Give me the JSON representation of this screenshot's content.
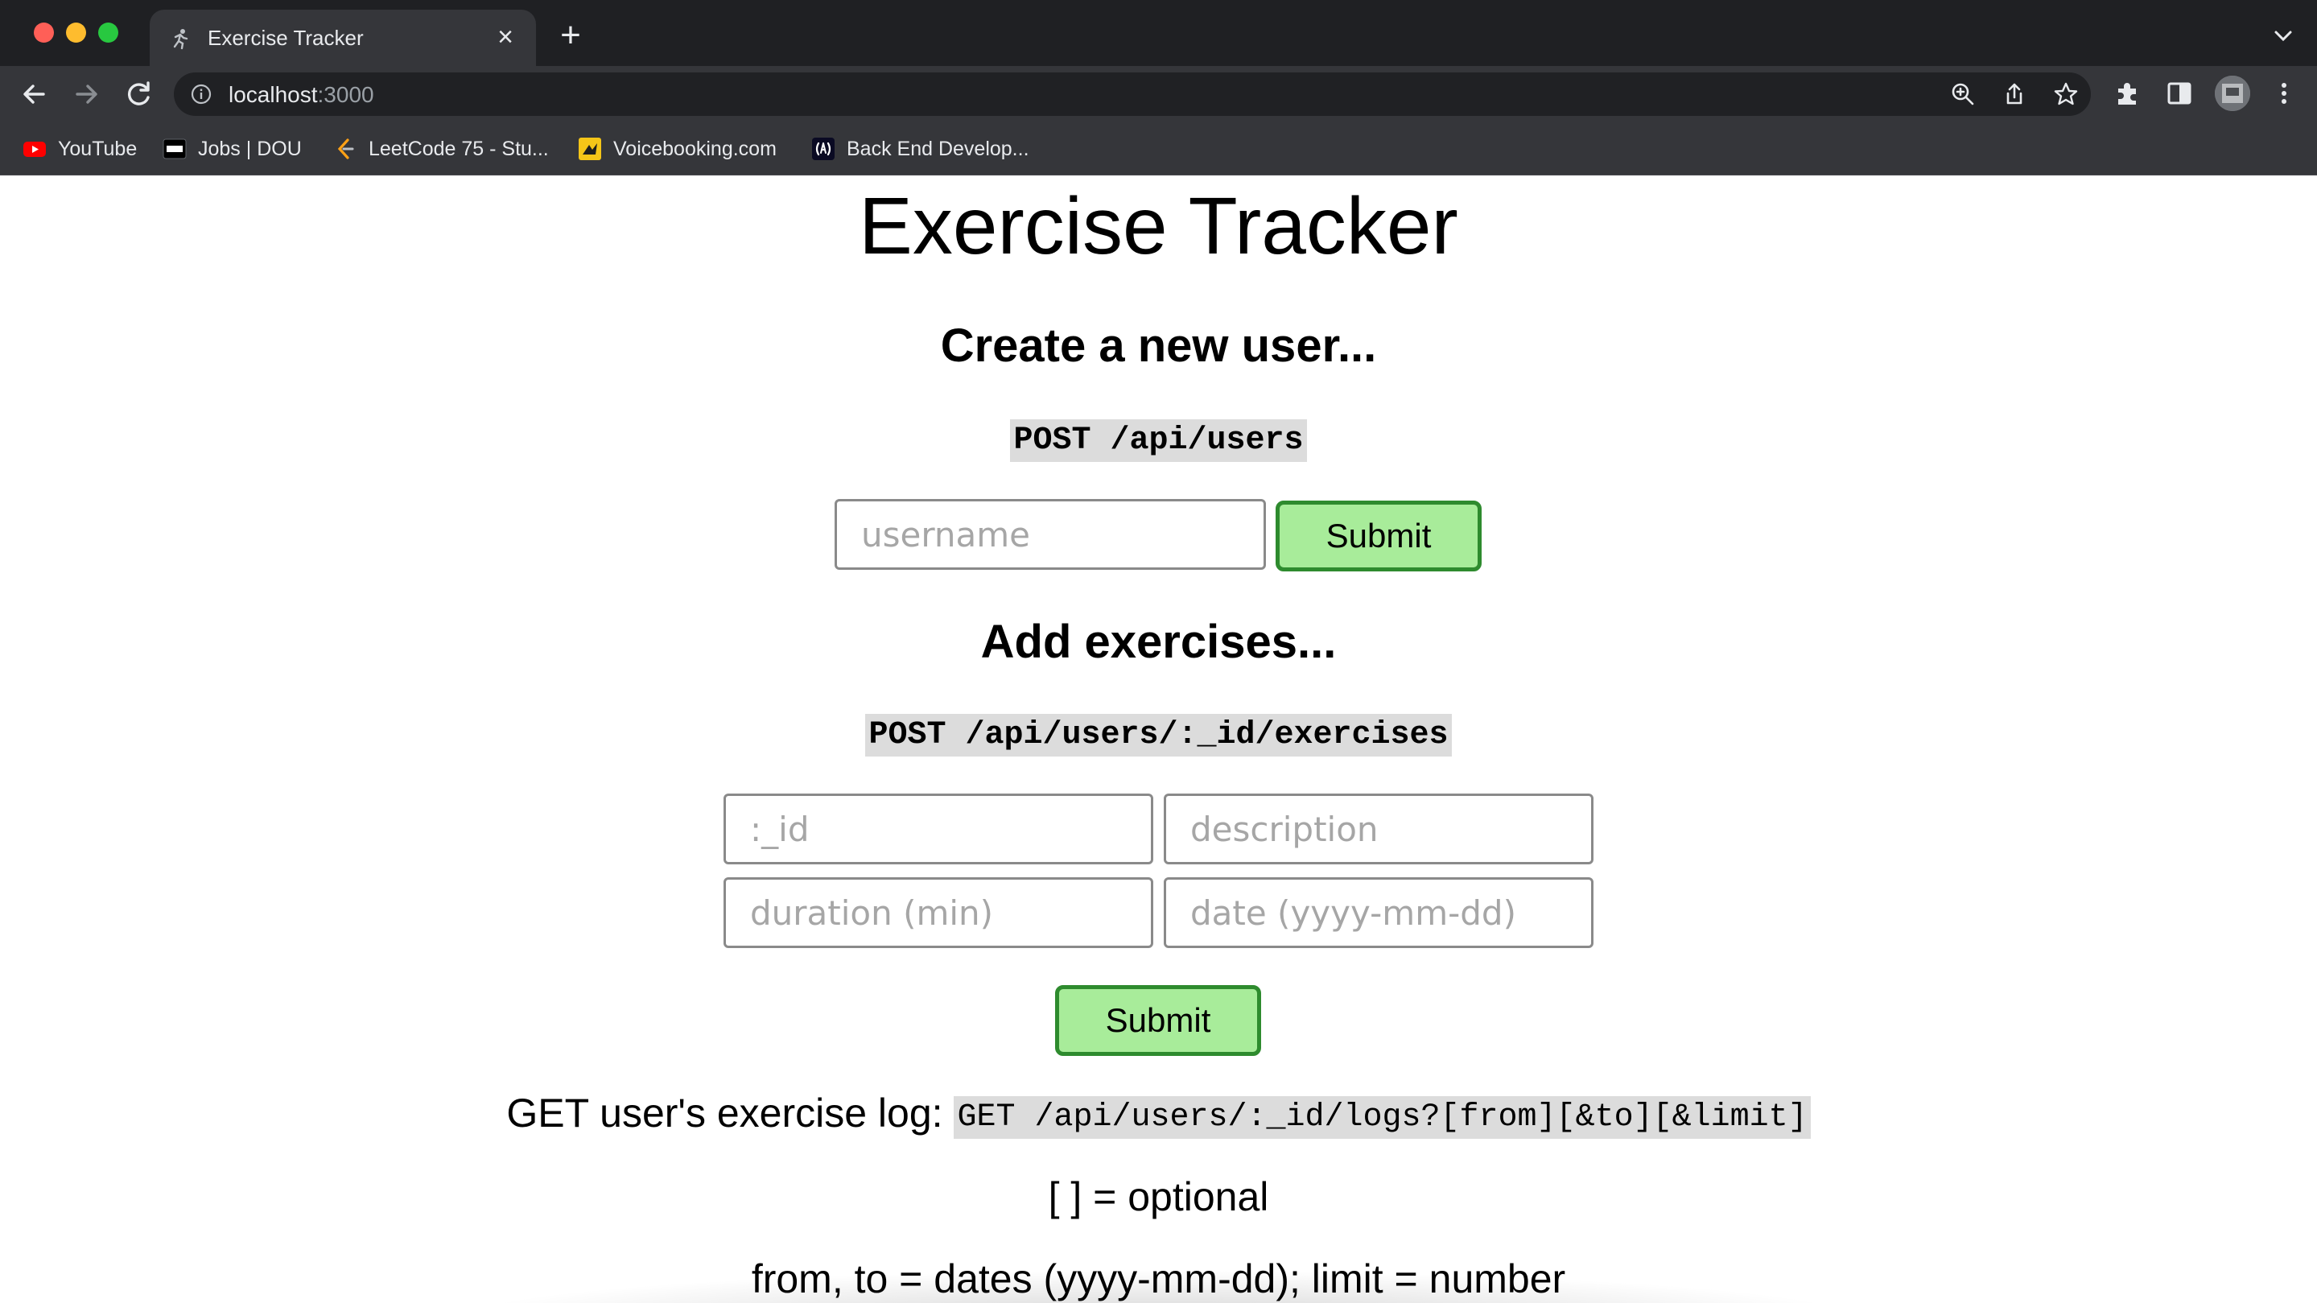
{
  "browser": {
    "tab": {
      "title": "Exercise Tracker",
      "close_glyph": "×"
    },
    "new_tab_glyph": "+",
    "address": {
      "host": "localhost",
      "port": ":3000"
    },
    "bookmarks": [
      {
        "label": "YouTube",
        "icon": "youtube-icon",
        "color": "#ff0000"
      },
      {
        "label": "Jobs | DOU",
        "icon": "dou-icon",
        "color": "#000000"
      },
      {
        "label": "LeetCode 75 - Stu...",
        "icon": "leetcode-icon",
        "color": "#ffa116"
      },
      {
        "label": "Voicebooking.com",
        "icon": "voicebooking-icon",
        "color": "#f5c518"
      },
      {
        "label": "Back End Develop...",
        "icon": "freecodecamp-icon",
        "color": "#0a0a23"
      }
    ],
    "colors": {
      "tabstrip": "#1f2023",
      "toolbar": "#35363a",
      "omnibox": "#202124"
    }
  },
  "page": {
    "title": "Exercise Tracker",
    "create_user": {
      "heading": "Create a new user...",
      "endpoint": "POST /api/users",
      "username_placeholder": "username",
      "submit_label": "Submit"
    },
    "add_exercise": {
      "heading": "Add exercises...",
      "endpoint": "POST /api/users/:_id/exercises",
      "id_placeholder": ":_id",
      "description_placeholder": "description",
      "duration_placeholder": "duration (min)",
      "date_placeholder": "date (yyyy-mm-dd)",
      "submit_label": "Submit"
    },
    "log": {
      "label": "GET user's exercise log: ",
      "endpoint": "GET /api/users/:_id/logs?[from][&to][&limit]",
      "optional_note": "[ ] = optional",
      "params_note": "from, to = dates (yyyy-mm-dd); limit = number"
    },
    "colors": {
      "submit_bg": "#a8ec9a",
      "submit_border": "#2e8b2e",
      "code_bg": "#dcdcdc"
    }
  }
}
